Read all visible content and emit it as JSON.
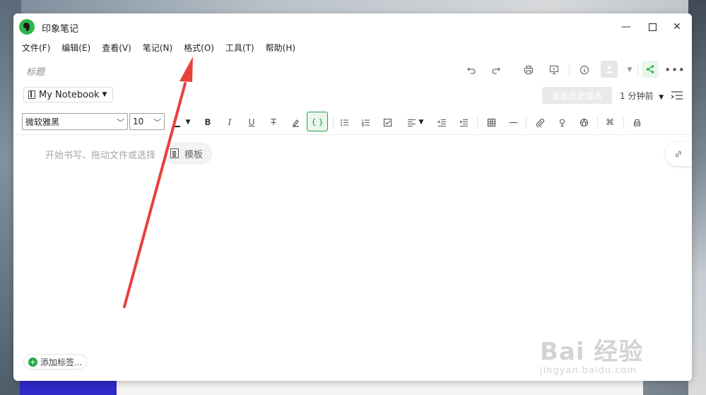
{
  "window": {
    "title": "印象笔记"
  },
  "menu": {
    "items": [
      "文件(F)",
      "编辑(E)",
      "查看(V)",
      "笔记(N)",
      "格式(O)",
      "工具(T)",
      "帮助(H)"
    ]
  },
  "note": {
    "title_placeholder": "标题",
    "editor_hint": "开始书写、拖动文件或选择",
    "template_label": "模板"
  },
  "notebook": {
    "name": "My Notebook"
  },
  "history": {
    "button_label": "查看历史版本",
    "time_ago": "1 分钟前"
  },
  "format": {
    "font_family": "微软雅黑",
    "font_size": "10"
  },
  "tags": {
    "add_label": "添加标签..."
  },
  "watermark": {
    "main": "Bai 经验",
    "sub": "jingyan.baidu.com"
  },
  "colors": {
    "accent": "#2db84a",
    "arrow": "#e8403c"
  }
}
